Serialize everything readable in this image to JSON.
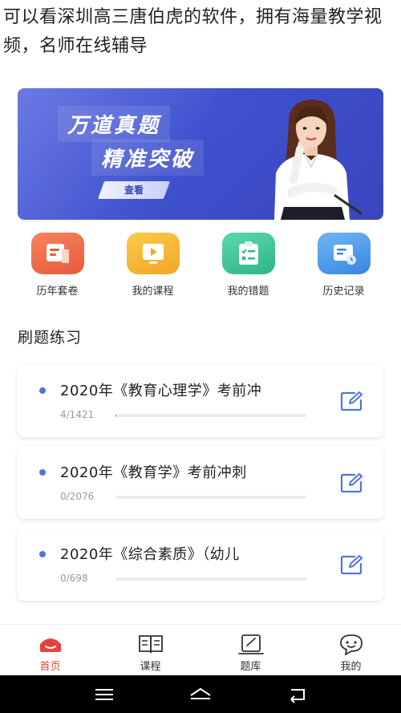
{
  "caption": "可以看深圳高三唐伯虎的软件，拥有海量教学视频，名师在线辅导",
  "banner": {
    "title_line1": "万道真题",
    "title_line2": "精准突破",
    "button_label": "查看"
  },
  "quick_actions": [
    {
      "label": "历年套卷",
      "icon": "exam-paper-icon",
      "color": "#ee6b48"
    },
    {
      "label": "我的课程",
      "icon": "video-course-icon",
      "color": "#f5b62d"
    },
    {
      "label": "我的错题",
      "icon": "mistakes-checklist-icon",
      "color": "#3fc49a"
    },
    {
      "label": "历史记录",
      "icon": "history-record-icon",
      "color": "#4a9be8"
    }
  ],
  "practice": {
    "section_title": "刷题练习",
    "items": [
      {
        "name": "2020年《教育心理学》考前冲",
        "progress_text": "4/1421",
        "progress": 0.003
      },
      {
        "name": "2020年《教育学》考前冲刺",
        "progress_text": "0/2076",
        "progress": 0
      },
      {
        "name": "2020年《综合素质》（幼儿",
        "progress_text": "0/698",
        "progress": 0
      }
    ]
  },
  "tabbar": {
    "items": [
      {
        "label": "首页",
        "icon": "home-icon",
        "active": true
      },
      {
        "label": "课程",
        "icon": "book-icon",
        "active": false
      },
      {
        "label": "题库",
        "icon": "question-bank-icon",
        "active": false
      },
      {
        "label": "我的",
        "icon": "profile-chat-icon",
        "active": false
      }
    ]
  },
  "colors": {
    "accent_red": "#e8413a",
    "progress_blue": "#5b7be8",
    "banner_blue": "#3f51cf"
  }
}
